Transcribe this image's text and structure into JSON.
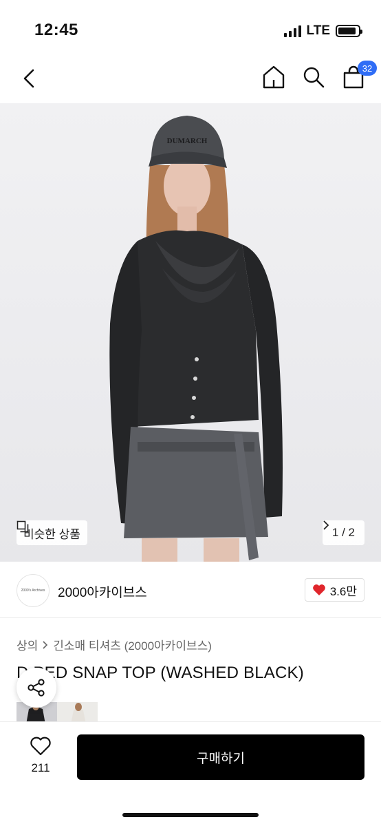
{
  "status": {
    "time": "12:45",
    "network": "LTE",
    "battery_level": 0.9
  },
  "nav": {
    "back_icon": "chevron-left-icon",
    "home_icon": "home-icon",
    "search_icon": "search-icon",
    "cart_icon": "shopping-bag-icon",
    "cart_count": "32"
  },
  "hero": {
    "similar_label": "비슷한 상품",
    "page": "1 / 2"
  },
  "seller": {
    "logo_text": "2000's Archives",
    "name": "2000아카이브스",
    "likes": "3.6만"
  },
  "breadcrumb": {
    "category": "상의",
    "subcategory": "긴소매 티셔츠 (2000아카이브스)"
  },
  "product": {
    "title": "D  PED SNAP TOP (WASHED BLACK)"
  },
  "bottom": {
    "wish_count": "211",
    "buy_label": "구매하기"
  },
  "colors": {
    "accent": "#2f6df6",
    "heart": "#e0262c",
    "buy_bg": "#000000"
  }
}
